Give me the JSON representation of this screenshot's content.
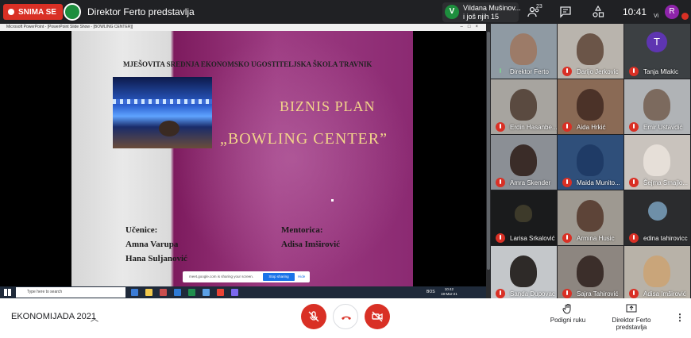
{
  "topbar": {
    "recording_label": "SNIMA SE",
    "presenter_title": "Direktor Ferto predstavlja",
    "notification": {
      "avatar_letter": "V",
      "line1": "Vildana Mušinov...",
      "line2": "i još njih 15"
    },
    "participant_count": "23",
    "clock": "10:41",
    "you_label": "Vi",
    "user_avatar_letter": "R"
  },
  "presentation": {
    "window_title": "Microsoft PowerPoint - [PowerPoint Slide Show - [BOWLING CENTER]]",
    "slide": {
      "school": "MJEŠOVITA SREDNJA EKONOMSKO UGOSTITELJSKA ŠKOLA TRAVNIK",
      "heading": "BIZNIS PLAN",
      "title": "„BOWLING CENTER”",
      "students_label": "Učenice:",
      "student1": "Amna Varupa",
      "student2": "Hana Suljanović",
      "mentor_label": "Mentorica:",
      "mentor": "Adisa Imširović"
    },
    "share_bar": {
      "text": "meet.google.com is sharing your screen.",
      "stop": "Stop sharing",
      "hide": "Hide"
    },
    "taskbar": {
      "search_placeholder": "Type here to search",
      "lang": "BOS",
      "time": "10:42",
      "date": "19-Mar-21"
    }
  },
  "participants": [
    {
      "name": "Direktor Ferto",
      "muted": false
    },
    {
      "name": "Darijo Jerkovic",
      "muted": true
    },
    {
      "name": "Tanja Mlakic",
      "muted": true,
      "avatar_letter": "T"
    },
    {
      "name": "Erdin Hasanbe...",
      "muted": true
    },
    {
      "name": "Aida Hrkić",
      "muted": true
    },
    {
      "name": "Emir Ustavdić",
      "muted": true
    },
    {
      "name": "Amra Skender",
      "muted": true
    },
    {
      "name": "Maida Munito...",
      "muted": true
    },
    {
      "name": "Šejma Smajlo...",
      "muted": true
    },
    {
      "name": "Larisa Srkalović",
      "muted": true
    },
    {
      "name": "Armina Husic",
      "muted": true
    },
    {
      "name": "edina tahirovicc",
      "muted": true
    },
    {
      "name": "Sanda Dupovac",
      "muted": true
    },
    {
      "name": "Sajra Tahirović",
      "muted": true
    },
    {
      "name": "Adisa Imširović",
      "muted": true
    }
  ],
  "bottombar": {
    "meeting_name": "EKONOMIJADA 2021",
    "raise_hand": "Podigni ruku",
    "presenting_line1": "Direktor Ferto",
    "presenting_line2": "predstavlja"
  }
}
